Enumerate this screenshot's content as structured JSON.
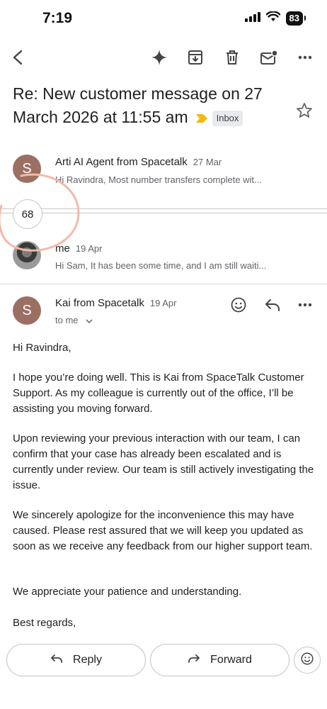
{
  "status_bar": {
    "time": "7:19",
    "battery": "83"
  },
  "toolbar": {
    "icons": [
      "back-icon",
      "sparkle-icon",
      "archive-icon",
      "delete-icon",
      "mark-unread-icon",
      "more-icon"
    ]
  },
  "subject": {
    "text": "Re: New customer message on 27 March 2026 at 11:55 am",
    "label": "Inbox",
    "label_color": "#f2b90f"
  },
  "messages": {
    "first": {
      "avatar_letter": "S",
      "sender": "Arti AI Agent from Spacetalk",
      "date": "27 Mar",
      "snippet": "Hi Ravindra, Most number transfers complete wit..."
    },
    "collapsed_count": "68",
    "second": {
      "sender": "me",
      "date": "19 Apr",
      "snippet": "Hi Sam, It has been some time, and I am still waiti..."
    },
    "open": {
      "avatar_letter": "S",
      "sender": "Kai from Spacetalk",
      "date": "19 Apr",
      "recipient": "to me",
      "body": [
        "Hi Ravindra,",
        "I hope you’re doing well. This is Kai from SpaceTalk Customer Support. As my colleague is currently out of the office, I’ll be assisting you moving forward.",
        "Upon reviewing your previous interaction with our team, I can confirm that your case has already been escalated and is currently under review. Our team is still actively investigating the issue.",
        "We sincerely apologize for the inconvenience this may have caused. Please rest assured that we will keep you updated as soon as we receive any feedback from our higher support team.",
        "We appreciate your patience and understanding.",
        "Best regards,"
      ]
    }
  },
  "actions": {
    "reply": "Reply",
    "forward": "Forward"
  },
  "colors": {
    "avatar": "#9c6f63",
    "annotation": "#f4b9a7"
  }
}
